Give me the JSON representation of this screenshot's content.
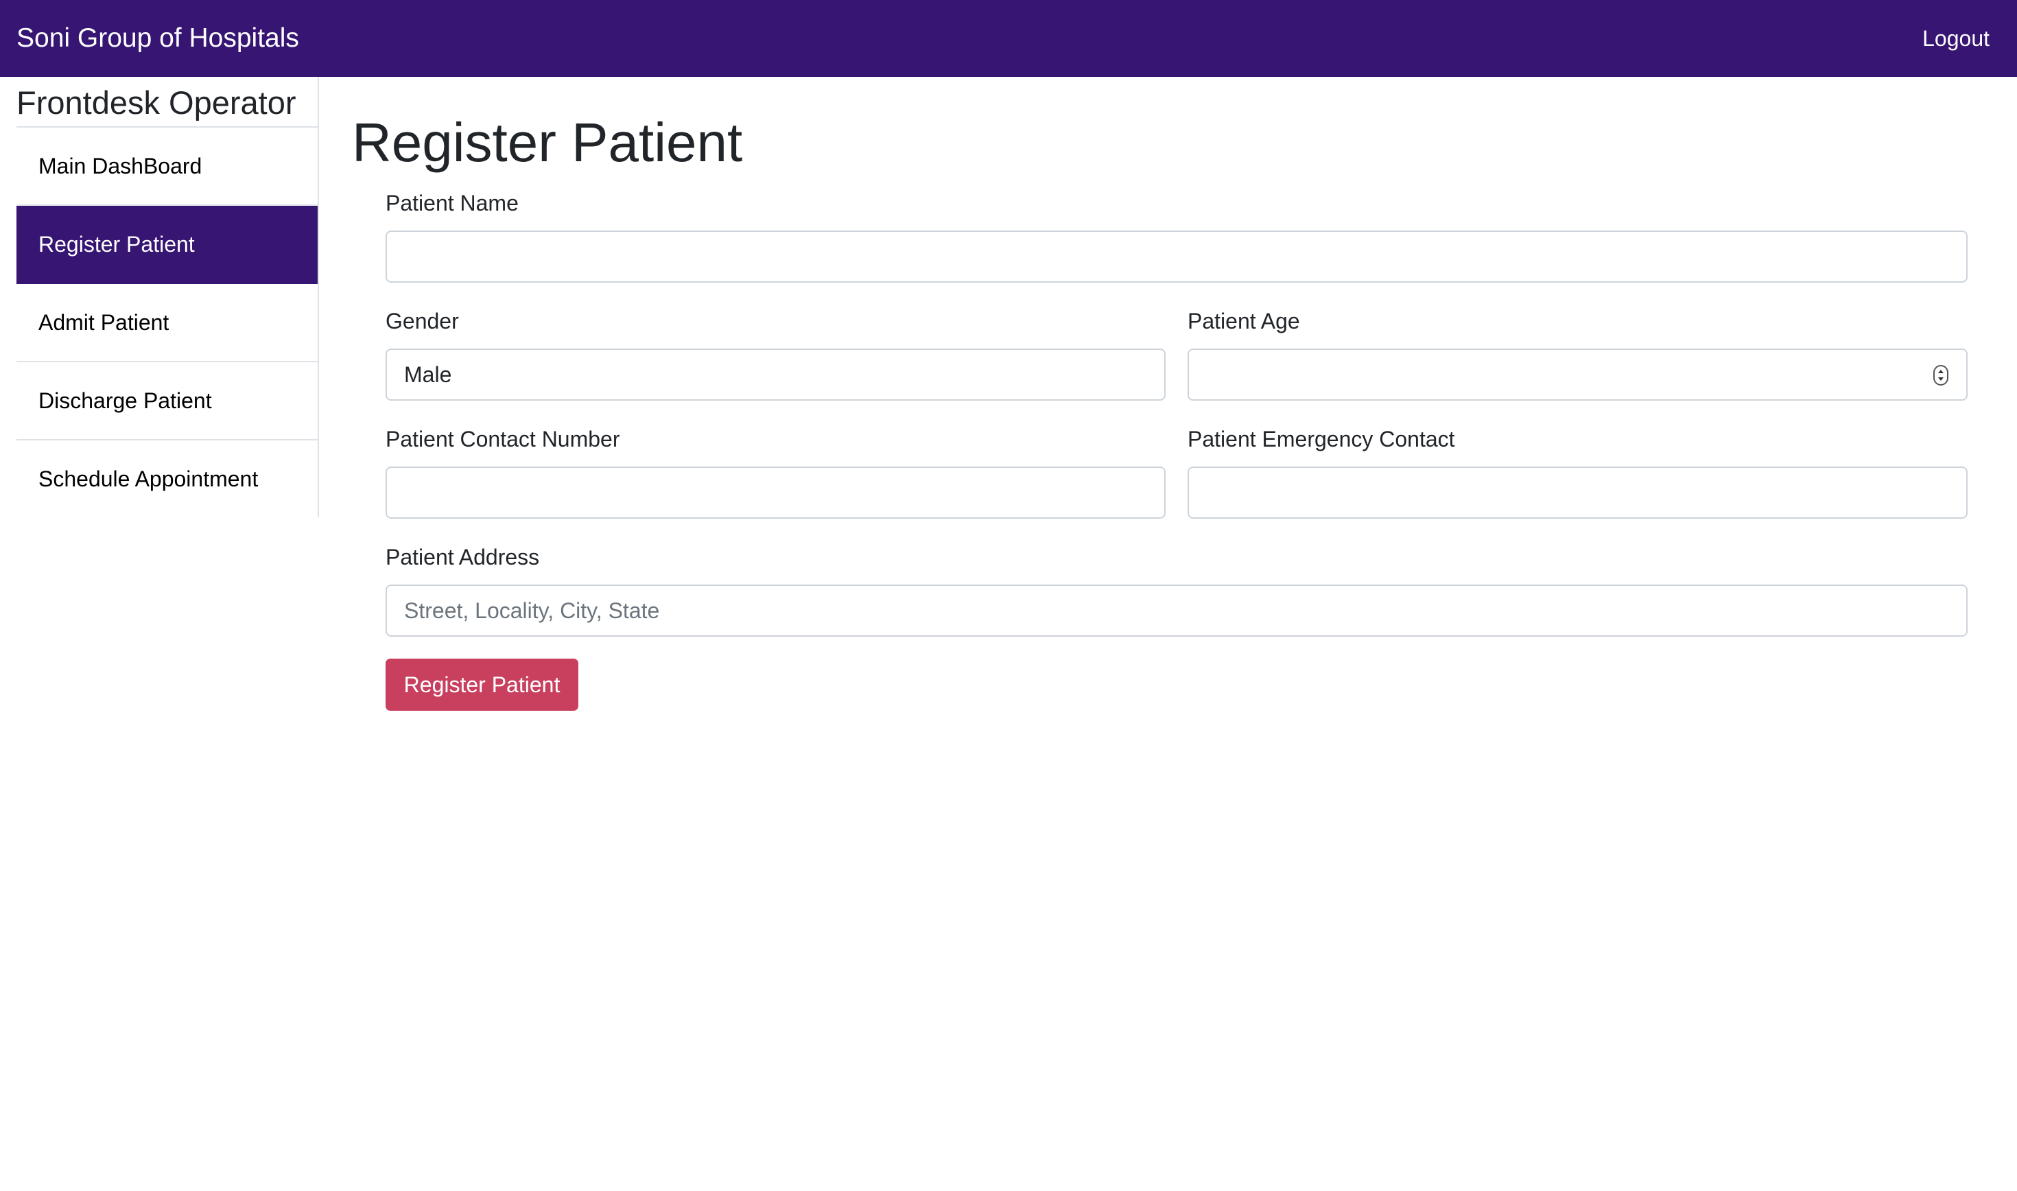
{
  "navbar": {
    "brand": "Soni Group of Hospitals",
    "logout_label": "Logout"
  },
  "sidebar": {
    "title": "Frontdesk Operator",
    "items": [
      {
        "label": "Main DashBoard",
        "active": false
      },
      {
        "label": "Register Patient",
        "active": true
      },
      {
        "label": "Admit Patient",
        "active": false
      },
      {
        "label": "Discharge Patient",
        "active": false
      },
      {
        "label": "Schedule Appointment",
        "active": false
      }
    ]
  },
  "main": {
    "title": "Register Patient",
    "form": {
      "patient_name": {
        "label": "Patient Name",
        "value": ""
      },
      "gender": {
        "label": "Gender",
        "value": "Male"
      },
      "patient_age": {
        "label": "Patient Age",
        "value": ""
      },
      "contact_number": {
        "label": "Patient Contact Number",
        "value": ""
      },
      "emergency_contact": {
        "label": "Patient Emergency Contact",
        "value": ""
      },
      "address": {
        "label": "Patient Address",
        "value": "",
        "placeholder": "Street, Locality, City, State"
      },
      "submit_label": "Register Patient"
    }
  },
  "colors": {
    "navbar": "#371572",
    "active_nav": "#371572",
    "submit_button": "#c9405f"
  }
}
